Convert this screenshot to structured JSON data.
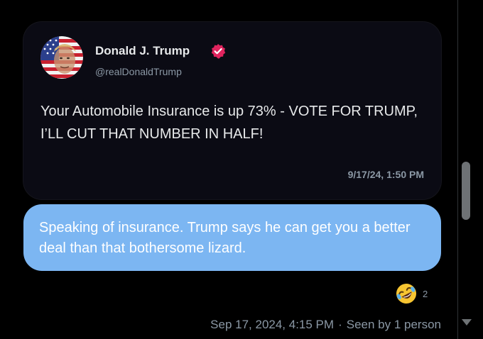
{
  "tweet": {
    "author_name": "Donald J. Trump",
    "author_handle": "@realDonaldTrump",
    "text": "Your Automobile Insurance is up 73% - VOTE FOR TRUMP, I’LL CUT THAT NUMBER IN HALF!",
    "timestamp": "9/17/24, 1:50 PM",
    "avatar_icon": "avatar-flag-portrait",
    "verified_icon": "verified-badge-icon"
  },
  "message": {
    "text": "Speaking of insurance. Trump says he can get you a better deal than that bothersome lizard."
  },
  "reaction": {
    "icon": "rolling-on-floor-laughing-emoji",
    "count": "2"
  },
  "meta": {
    "sent_time": "Sep 17, 2024, 4:15 PM",
    "separator": "·",
    "seen": "Seen by 1 person"
  },
  "colors": {
    "background": "#000000",
    "tweet_card": "#0b0b14",
    "bubble": "#7cb6f2",
    "verified": "#e0245e",
    "muted_text": "#8b98a5"
  }
}
